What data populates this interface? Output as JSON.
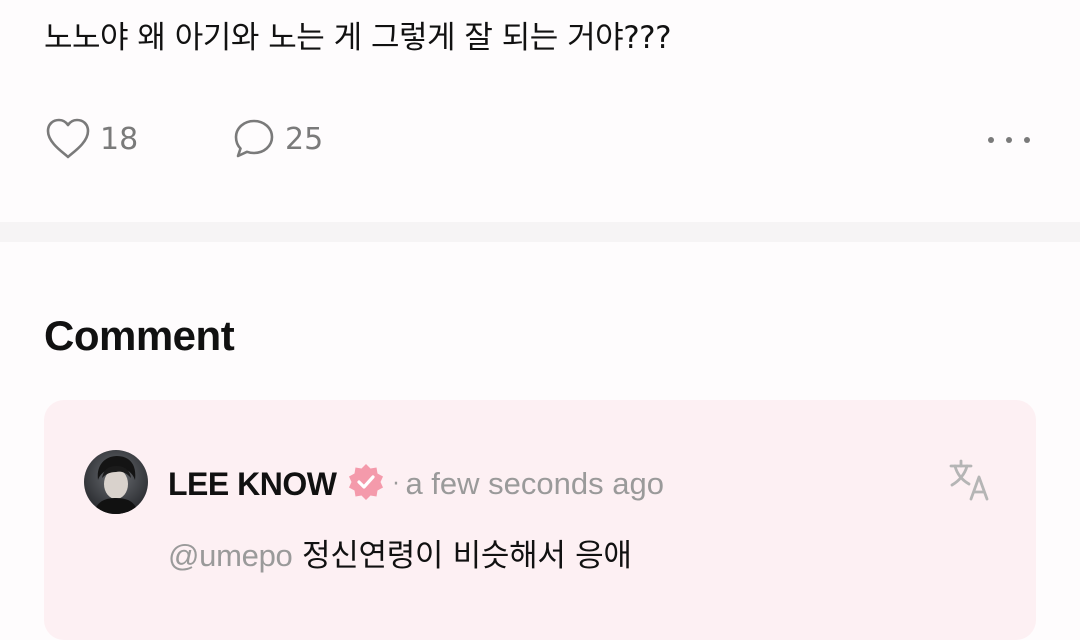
{
  "post": {
    "text": "노노야 왜 아기와 노는 게 그렇게 잘 되는 거야???",
    "likes": "18",
    "comments": "25"
  },
  "section": {
    "title": "Comment"
  },
  "comment": {
    "author": "LEE KNOW",
    "separator": "·",
    "time": "a few seconds ago",
    "mention": "@umepo",
    "text": "정신연령이 비슷해서 응애"
  },
  "icons": {
    "like": "heart-outline-icon",
    "comment": "speech-bubble-icon",
    "more": "ellipsis-icon",
    "verified": "verified-badge-icon",
    "translate": "translate-icon"
  },
  "colors": {
    "accent": "#f49aab",
    "muted": "#9a9a9a",
    "card_bg": "#fdf0f3",
    "divider": "#f6f4f5"
  }
}
